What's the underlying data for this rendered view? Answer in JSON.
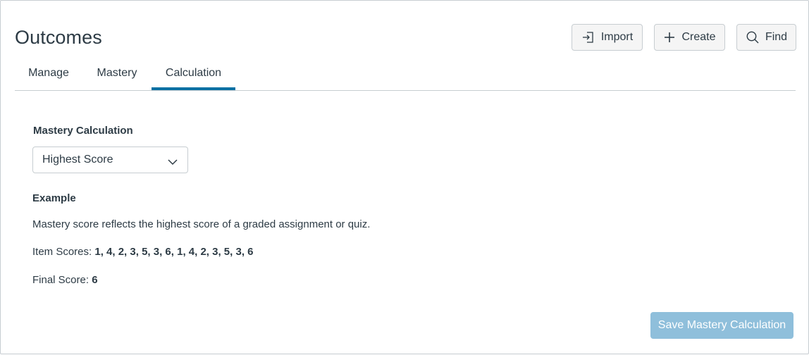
{
  "page": {
    "title": "Outcomes"
  },
  "toolbar": {
    "import_label": "Import",
    "create_label": "Create",
    "find_label": "Find",
    "import_icon": "import-icon",
    "create_icon": "plus-icon",
    "find_icon": "search-icon"
  },
  "tabs": [
    {
      "label": "Manage",
      "active": false
    },
    {
      "label": "Mastery",
      "active": false
    },
    {
      "label": "Calculation",
      "active": true
    }
  ],
  "calculation": {
    "section_label": "Mastery Calculation",
    "select_value": "Highest Score",
    "example_heading": "Example",
    "description": "Mastery score reflects the highest score of a graded assignment or quiz.",
    "item_scores_label": "Item Scores: ",
    "item_scores_value": "1, 4, 2, 3, 5, 3, 6, 1, 4, 2, 3, 5, 3, 6",
    "final_score_label": "Final Score: ",
    "final_score_value": "6",
    "save_label": "Save Mastery Calculation"
  },
  "colors": {
    "accent": "#0770a3",
    "save_disabled_bg": "#8fbfdb",
    "text": "#2d3b45",
    "border": "#c7cdd1"
  }
}
